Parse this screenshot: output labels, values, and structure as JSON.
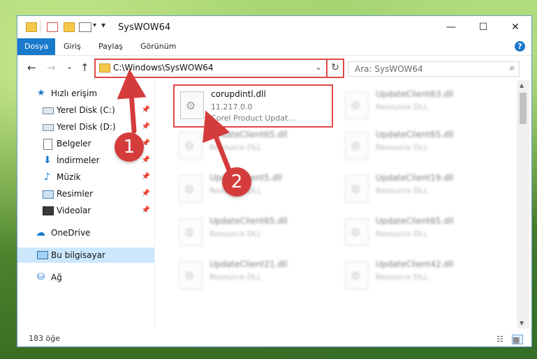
{
  "window": {
    "title": "SysWOW64",
    "minimize_glyph": "—",
    "maximize_glyph": "☐",
    "close_glyph": "✕"
  },
  "ribbon": {
    "tabs": [
      "Dosya",
      "Giriş",
      "Paylaş",
      "Görünüm"
    ],
    "help_glyph": "?"
  },
  "nav": {
    "back_glyph": "←",
    "forward_glyph": "→",
    "recent_glyph": "⌄",
    "up_glyph": "↑",
    "address": "C:\\Windows\\SysWOW64",
    "dropdown_glyph": "⌄",
    "refresh_glyph": "↻",
    "search_placeholder": "Ara: SysWOW64",
    "search_glyph": "⌕"
  },
  "sidebar": {
    "items": [
      {
        "label": "Hızlı erişim",
        "icon": "star-icon",
        "pinned": false
      },
      {
        "label": "Yerel Disk (C:)",
        "icon": "drive-icon",
        "pinned": true
      },
      {
        "label": "Yerel Disk (D:)",
        "icon": "drive-icon",
        "pinned": true
      },
      {
        "label": "Belgeler",
        "icon": "documents-icon",
        "pinned": true
      },
      {
        "label": "İndirmeler",
        "icon": "downloads-icon",
        "pinned": true
      },
      {
        "label": "Müzik",
        "icon": "music-icon",
        "pinned": true
      },
      {
        "label": "Resimler",
        "icon": "pictures-icon",
        "pinned": true
      },
      {
        "label": "Videolar",
        "icon": "videos-icon",
        "pinned": true
      },
      {
        "label": "OneDrive",
        "icon": "cloud-icon",
        "pinned": false
      },
      {
        "label": "Bu bilgisayar",
        "icon": "computer-icon",
        "pinned": false,
        "selected": true
      },
      {
        "label": "Ağ",
        "icon": "network-icon",
        "pinned": false
      }
    ],
    "pin_glyph": "📌"
  },
  "files": {
    "highlighted": {
      "name": "corupdintl.dll",
      "version": "11.217.0.0",
      "description": "Corel Product Updat..."
    },
    "left_column": [
      {
        "name": "UpdateClient65.dll",
        "description": "Resource DLL"
      },
      {
        "name": "UpdateClient5.dll",
        "description": "Resource DLL"
      },
      {
        "name": "UpdateClient65.dll",
        "description": "Resource DLL"
      },
      {
        "name": "UpdateClient21.dll",
        "description": "Resource DLL"
      }
    ],
    "right_column": [
      {
        "name": "UpdateClient63.dll",
        "description": "Resource DLL"
      },
      {
        "name": "UpdateClient65.dll",
        "description": "Resource DLL"
      },
      {
        "name": "UpdateClient19.dll",
        "description": "Resource DLL"
      },
      {
        "name": "UpdateClient65.dll",
        "description": "Resource DLL"
      },
      {
        "name": "UpdateClient42.dll",
        "description": "Resource DLL"
      }
    ]
  },
  "status": {
    "count_text": "183 öğe",
    "details_view_glyph": "☷",
    "tiles_view_glyph": "▦"
  },
  "callouts": [
    "1",
    "2"
  ],
  "colors": {
    "accent": "#1979ca",
    "highlight": "#e04848",
    "callout": "#d43c3c"
  }
}
